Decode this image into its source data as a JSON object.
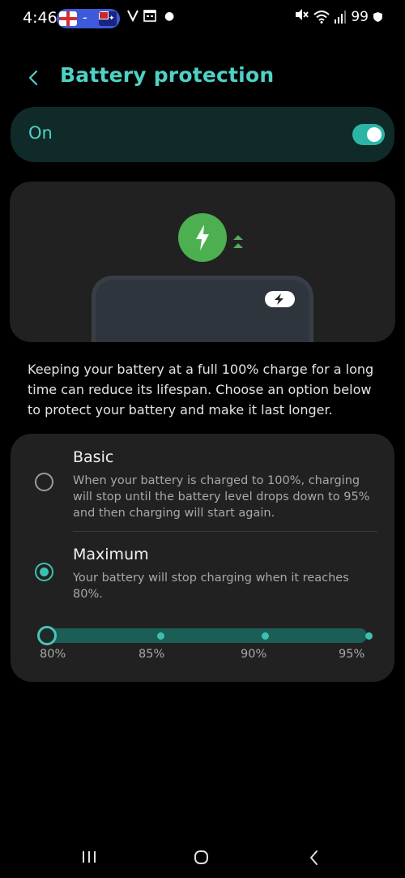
{
  "status_bar": {
    "time": "4:46",
    "score_separator": "-",
    "battery_level": "99",
    "icons": [
      "england-flag-icon",
      "australia-flag-icon",
      "missed-call-icon",
      "calendar-icon",
      "dot-icon",
      "mute-icon",
      "wifi-icon",
      "signal-icon",
      "battery-shield-icon"
    ]
  },
  "header": {
    "title": "Battery protection",
    "back_icon": "chevron-left-icon"
  },
  "master_switch": {
    "label": "On",
    "checked": true
  },
  "illustration": {
    "icons": [
      "charging-bolt-icon",
      "up-arrows-icon",
      "phone-battery-bolt-icon"
    ]
  },
  "description": "Keeping your battery at a full 100% charge for a long time can reduce its lifespan. Choose an option below to protect your battery and make it last longer.",
  "options": {
    "basic": {
      "title": "Basic",
      "description": "When your battery is charged to 100%, charging will stop until the battery level drops down to 95% and then charging will start again.",
      "selected": false
    },
    "maximum": {
      "title": "Maximum",
      "description": "Your battery will stop charging when it reaches 80%.",
      "selected": true
    }
  },
  "slider": {
    "labels": [
      "80%",
      "85%",
      "90%",
      "95%"
    ],
    "selected_value": "80%"
  },
  "nav_bar": {
    "icons": [
      "recents-icon",
      "home-icon",
      "back-icon"
    ]
  },
  "colors": {
    "accent": "#4fd1c5",
    "toggle_on": "#2cb5a5",
    "charge_green": "#4caf50",
    "card_background": "#212121",
    "switch_card_background": "#0f2a29"
  }
}
